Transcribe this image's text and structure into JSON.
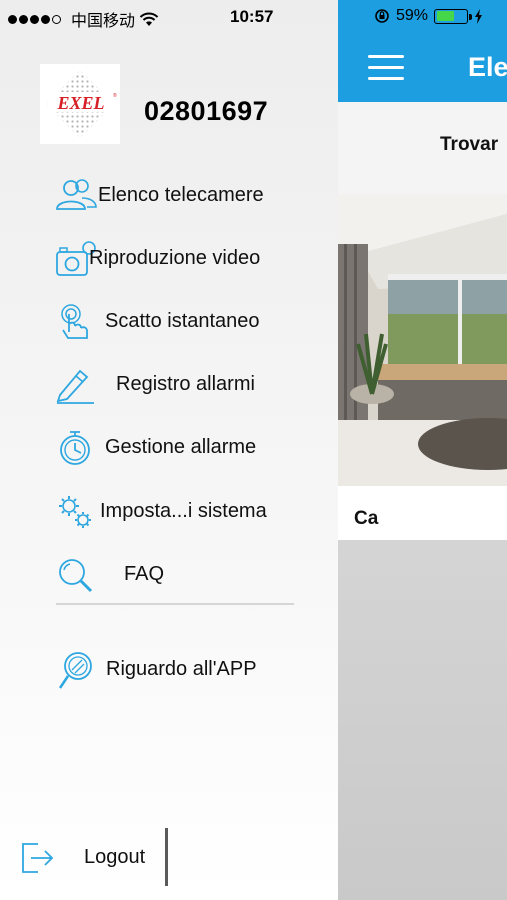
{
  "status_bar": {
    "carrier": "中国移动",
    "time": "10:57",
    "battery_percent": "59%",
    "battery_level": 0.59
  },
  "drawer": {
    "logo_text": "EXEL",
    "device_id": "02801697",
    "menu": [
      {
        "label": "Elenco telecamere",
        "icon": "users-icon"
      },
      {
        "label": "Riproduzione video",
        "icon": "camera-icon"
      },
      {
        "label": "Scatto istantaneo",
        "icon": "touch-icon"
      },
      {
        "label": "Registro allarmi",
        "icon": "pencil-icon"
      },
      {
        "label": "Gestione allarme",
        "icon": "alarm-clock-icon"
      },
      {
        "label": "Imposta...i sistema",
        "icon": "gears-icon"
      },
      {
        "label": "FAQ",
        "icon": "magnifier-icon"
      }
    ],
    "about": {
      "label": "Riguardo all'APP",
      "icon": "about-icon"
    },
    "logout": {
      "label": "Logout",
      "icon": "logout-icon"
    }
  },
  "main": {
    "title": "Ele",
    "subbar_text": "Trovar",
    "camera_name": "Ca"
  },
  "colors": {
    "accent": "#1c9ee0",
    "icon": "#2ea7e0"
  }
}
